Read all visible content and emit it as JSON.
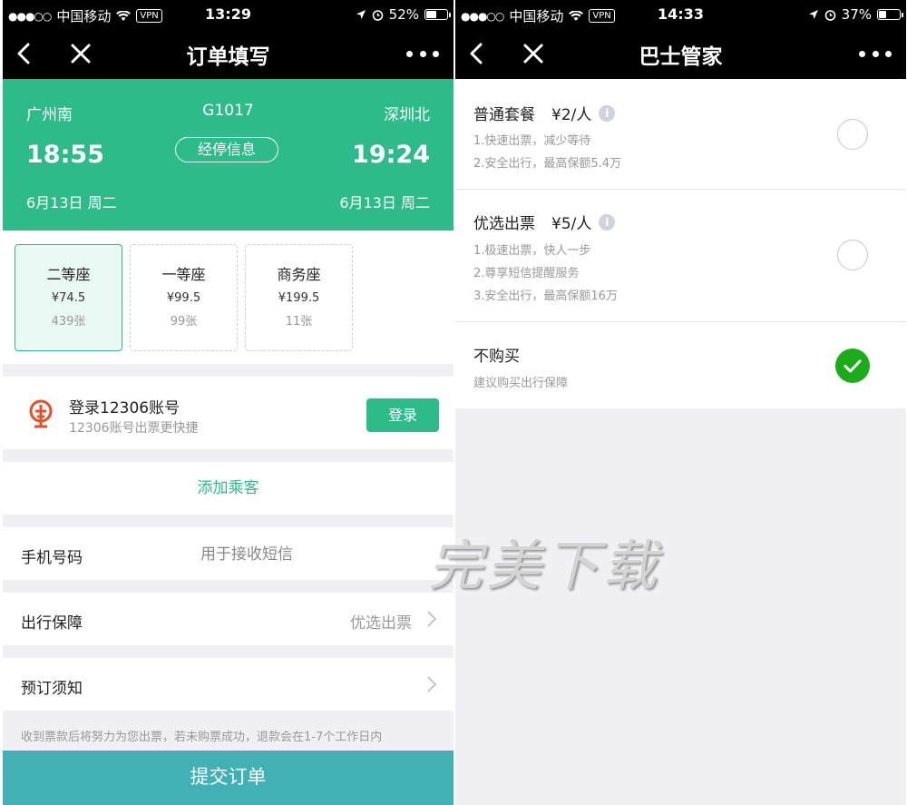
{
  "left": {
    "status": {
      "signal": "●●●○○",
      "carrier": "中国移动",
      "vpn": "VPN",
      "time": "13:29",
      "battery": "52%",
      "battery_level": 0.52
    },
    "nav": {
      "title": "订单填写"
    },
    "train": {
      "from_station": "广州南",
      "train_no": "G1017",
      "to_station": "深圳北",
      "dep_time": "18:55",
      "arr_time": "19:24",
      "stops_label": "经停信息",
      "dep_date": "6月13日 周二",
      "arr_date": "6月13日 周二"
    },
    "seats": [
      {
        "name": "二等座",
        "price": "¥74.5",
        "count": "439张"
      },
      {
        "name": "一等座",
        "price": "¥99.5",
        "count": "99张"
      },
      {
        "name": "商务座",
        "price": "¥199.5",
        "count": "11张"
      }
    ],
    "login": {
      "title": "登录12306账号",
      "subtitle": "12306账号出票更快捷",
      "button": "登录"
    },
    "add_passenger": "添加乘客",
    "phone": {
      "label": "手机号码",
      "placeholder": "用于接收短信"
    },
    "guarantee": {
      "label": "出行保障",
      "value": "优选出票"
    },
    "booking_notice": {
      "label": "预订须知"
    },
    "notice_text": "收到票款后将努力为您出票，若未购票成功，退款会在1-7个工作日内",
    "submit": "提交订单"
  },
  "right": {
    "status": {
      "signal": "●●●○○",
      "carrier": "中国移动",
      "vpn": "VPN",
      "time": "14:33",
      "battery": "37%",
      "battery_level": 0.37
    },
    "nav": {
      "title": "巴士管家"
    },
    "options": [
      {
        "name": "普通套餐",
        "price": "¥2/人",
        "lines": [
          "1.快速出票，减少等待",
          "2.安全出行，最高保额5.4万"
        ],
        "selected": false
      },
      {
        "name": "优选出票",
        "price": "¥5/人",
        "lines": [
          "1.极速出票，快人一步",
          "2.尊享短信提醒服务",
          "3.安全出行，最高保额16万"
        ],
        "selected": false
      },
      {
        "name": "不购买",
        "price": "",
        "lines": [
          "建议购买出行保障"
        ],
        "selected": true
      }
    ]
  },
  "watermark": "完美下载",
  "colors": {
    "brand_green": "#2dbb8a",
    "submit_teal": "#42b1b6",
    "check_green": "#1aad19"
  }
}
